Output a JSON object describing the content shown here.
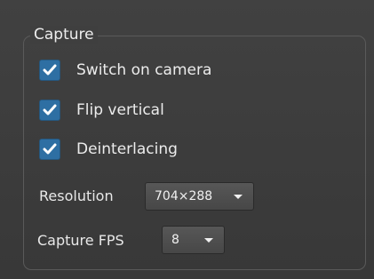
{
  "group": {
    "title": "Capture"
  },
  "checkboxes": [
    {
      "label": "Switch on camera",
      "checked": true
    },
    {
      "label": "Flip vertical",
      "checked": true
    },
    {
      "label": "Deinterlacing",
      "checked": true
    }
  ],
  "resolution": {
    "label": "Resolution",
    "value": "704×288"
  },
  "capture_fps": {
    "label": "Capture FPS",
    "value": "8"
  },
  "colors": {
    "checkbox_accent": "#2e6fa3",
    "background": "#3a3a3a"
  }
}
